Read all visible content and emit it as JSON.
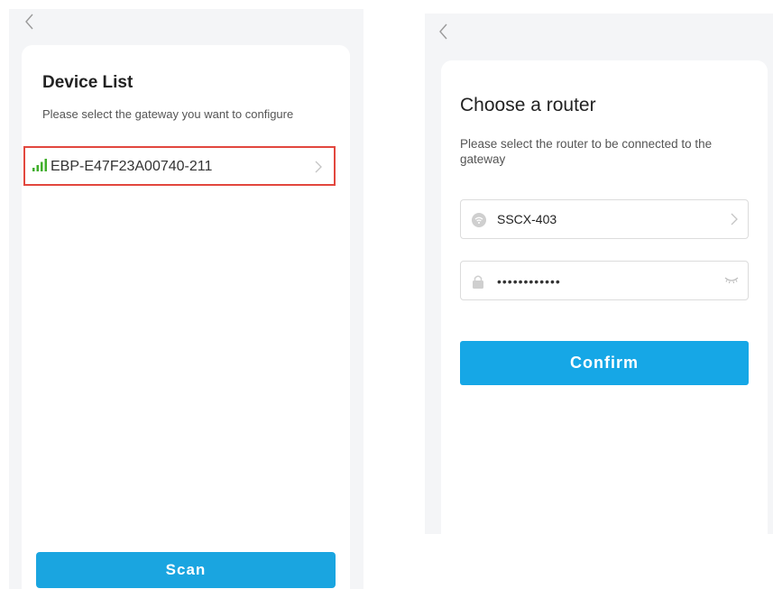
{
  "left_screen": {
    "title": "Device List",
    "subtitle": "Please select the gateway you want to configure",
    "devices": [
      {
        "name": "EBP-E47F23A00740-211",
        "icon": "signal-strength-icon",
        "selected": true
      }
    ],
    "scan_label": "Scan"
  },
  "right_screen": {
    "title": "Choose a router",
    "subtitle": "Please select the router to be connected to the gateway",
    "ssid": "SSCX-403",
    "password_value": "••••••••••••",
    "confirm_label": "Confirm"
  },
  "colors": {
    "accent_blue": "#16a7e6",
    "selection_border": "#e2473e",
    "signal_green": "#3fae2a"
  }
}
